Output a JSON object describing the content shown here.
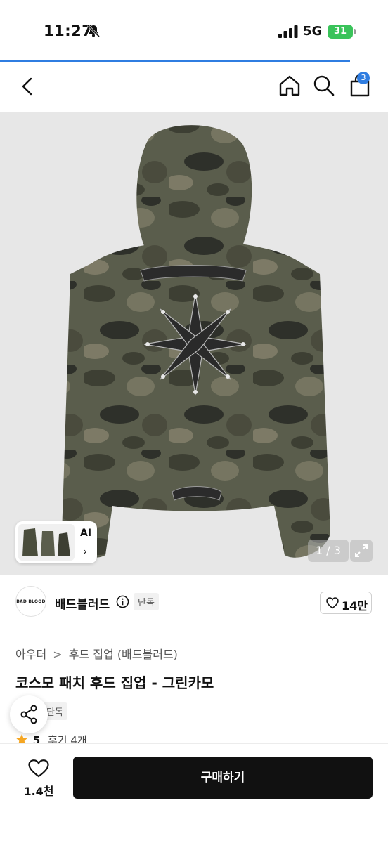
{
  "status_bar": {
    "time": "11:27",
    "network": "5G",
    "battery": "31"
  },
  "header": {
    "cart_badge": "3"
  },
  "image": {
    "ai_label": "AI",
    "ai_chevron": "›",
    "counter": "1 / 3"
  },
  "brand": {
    "logo_text": "BAD BLOOD",
    "name": "배드블러드",
    "badge": "단독",
    "likes": "14만"
  },
  "product": {
    "breadcrumb": [
      "아우터",
      "후드 집업 (배드블러드)"
    ],
    "breadcrumb_sep": ">",
    "title": "코스모 패치 후드 집업 - 그린카모",
    "badge": "단독",
    "rating": "5",
    "reviews": "후기 4개"
  },
  "bottom": {
    "wish_count": "1.4천",
    "buy_label": "구매하기"
  },
  "colors": {
    "accent_blue": "#2f7de1",
    "battery_green": "#3ac35a",
    "star_orange": "#f5a623",
    "buy_button": "#111111"
  },
  "icons": [
    "bell-off-icon",
    "signal-icon",
    "back-icon",
    "home-icon",
    "search-icon",
    "bag-icon",
    "chevron-left-icon",
    "expand-icon",
    "info-icon",
    "heart-icon",
    "share-icon",
    "star-icon"
  ]
}
